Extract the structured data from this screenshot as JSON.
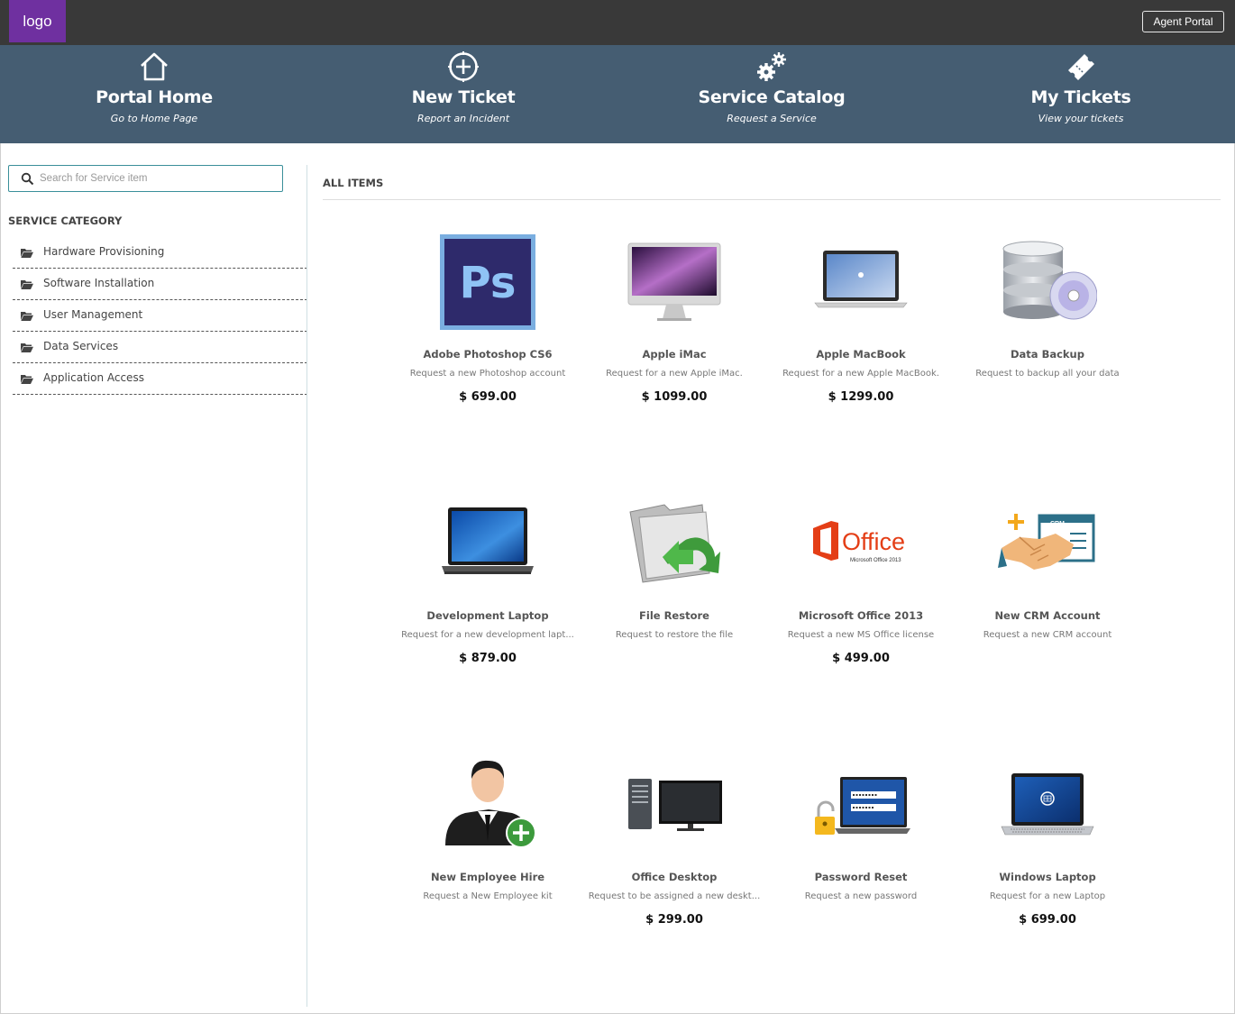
{
  "topbar": {
    "logo": "logo",
    "agent_portal": "Agent Portal"
  },
  "nav": [
    {
      "title": "Portal Home",
      "subtitle": "Go to Home Page",
      "icon": "home-icon"
    },
    {
      "title": "New Ticket",
      "subtitle": "Report an Incident",
      "icon": "plus-circle-icon"
    },
    {
      "title": "Service Catalog",
      "subtitle": "Request a Service",
      "icon": "gears-icon"
    },
    {
      "title": "My Tickets",
      "subtitle": "View your tickets",
      "icon": "ticket-icon"
    }
  ],
  "sidebar": {
    "search_placeholder": "Search for Service item",
    "heading": "SERVICE CATEGORY",
    "categories": [
      {
        "label": "Hardware Provisioning"
      },
      {
        "label": "Software Installation"
      },
      {
        "label": "User Management"
      },
      {
        "label": "Data Services"
      },
      {
        "label": "Application Access"
      }
    ]
  },
  "main": {
    "heading": "ALL ITEMS",
    "items": [
      {
        "name": "Adobe Photoshop CS6",
        "desc": "Request a new Photoshop account",
        "price": "$ 699.00",
        "icon": "photoshop-icon"
      },
      {
        "name": "Apple iMac",
        "desc": "Request for a new Apple iMac.",
        "price": "$ 1099.00",
        "icon": "imac-icon"
      },
      {
        "name": "Apple MacBook",
        "desc": "Request for a new Apple MacBook.",
        "price": "$ 1299.00",
        "icon": "macbook-icon"
      },
      {
        "name": "Data Backup",
        "desc": "Request to backup all your data",
        "price": "",
        "icon": "database-icon"
      },
      {
        "name": "Development Laptop",
        "desc": "Request for a new development lapt...",
        "price": "$ 879.00",
        "icon": "laptop-icon"
      },
      {
        "name": "File Restore",
        "desc": "Request to restore the file",
        "price": "",
        "icon": "folder-restore-icon"
      },
      {
        "name": "Microsoft Office 2013",
        "desc": "Request a new MS Office license",
        "price": "$ 499.00",
        "icon": "office-icon",
        "logo_text": "Office",
        "logo_sub": "Microsoft Office 2013"
      },
      {
        "name": "New CRM Account",
        "desc": "Request a new CRM account",
        "price": "",
        "icon": "crm-handshake-icon",
        "logo_text": "CRM"
      },
      {
        "name": "New Employee Hire",
        "desc": "Request a New Employee kit",
        "price": "",
        "icon": "employee-add-icon"
      },
      {
        "name": "Office Desktop",
        "desc": "Request to be assigned a new deskt...",
        "price": "$ 299.00",
        "icon": "desktop-icon"
      },
      {
        "name": "Password Reset",
        "desc": "Request a new password",
        "price": "",
        "icon": "password-reset-icon"
      },
      {
        "name": "Windows Laptop",
        "desc": "Request for a new Laptop",
        "price": "$ 699.00",
        "icon": "windows-laptop-icon"
      }
    ]
  }
}
